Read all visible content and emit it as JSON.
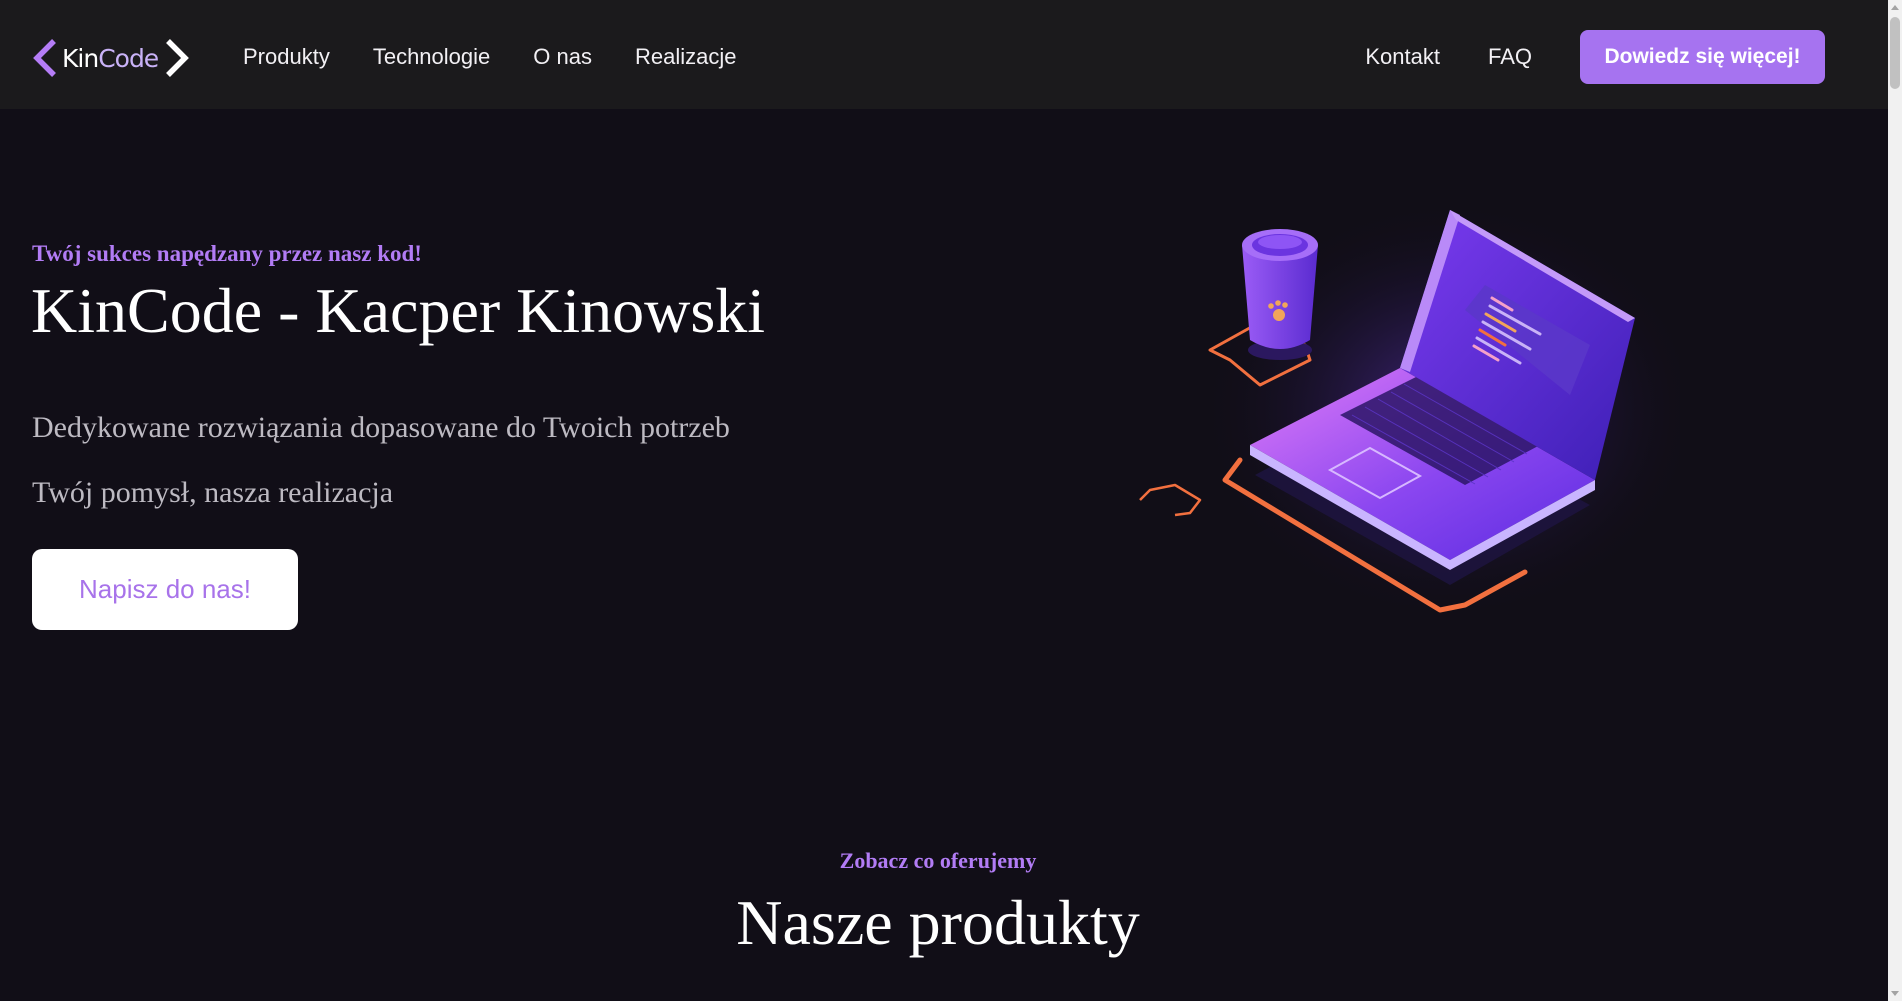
{
  "header": {
    "logo": {
      "left": "Kin",
      "right": "Code"
    },
    "nav_left": [
      "Produkty",
      "Technologie",
      "O nas",
      "Realizacje"
    ],
    "nav_right": [
      "Kontakt",
      "FAQ"
    ],
    "cta": "Dowiedz się więcej!"
  },
  "hero": {
    "tagline": "Twój sukces napędzany przez nasz kod!",
    "title": "KinCode - Kacper Kinowski",
    "line1": "Dedykowane rozwiązania dopasowane do Twoich potrzeb",
    "line2": "Twój pomysł, nasza realizacja",
    "button": "Napisz do nas!"
  },
  "products": {
    "tagline": "Zobacz co oferujemy",
    "title": "Nasze produkty"
  },
  "colors": {
    "accent": "#a673f0",
    "background": "#110e17",
    "header": "#1b1a1c"
  },
  "icons": {
    "logo_left": "chevron-left-icon",
    "logo_right": "chevron-right-icon",
    "illustration": "laptop-coffee-illustration"
  }
}
